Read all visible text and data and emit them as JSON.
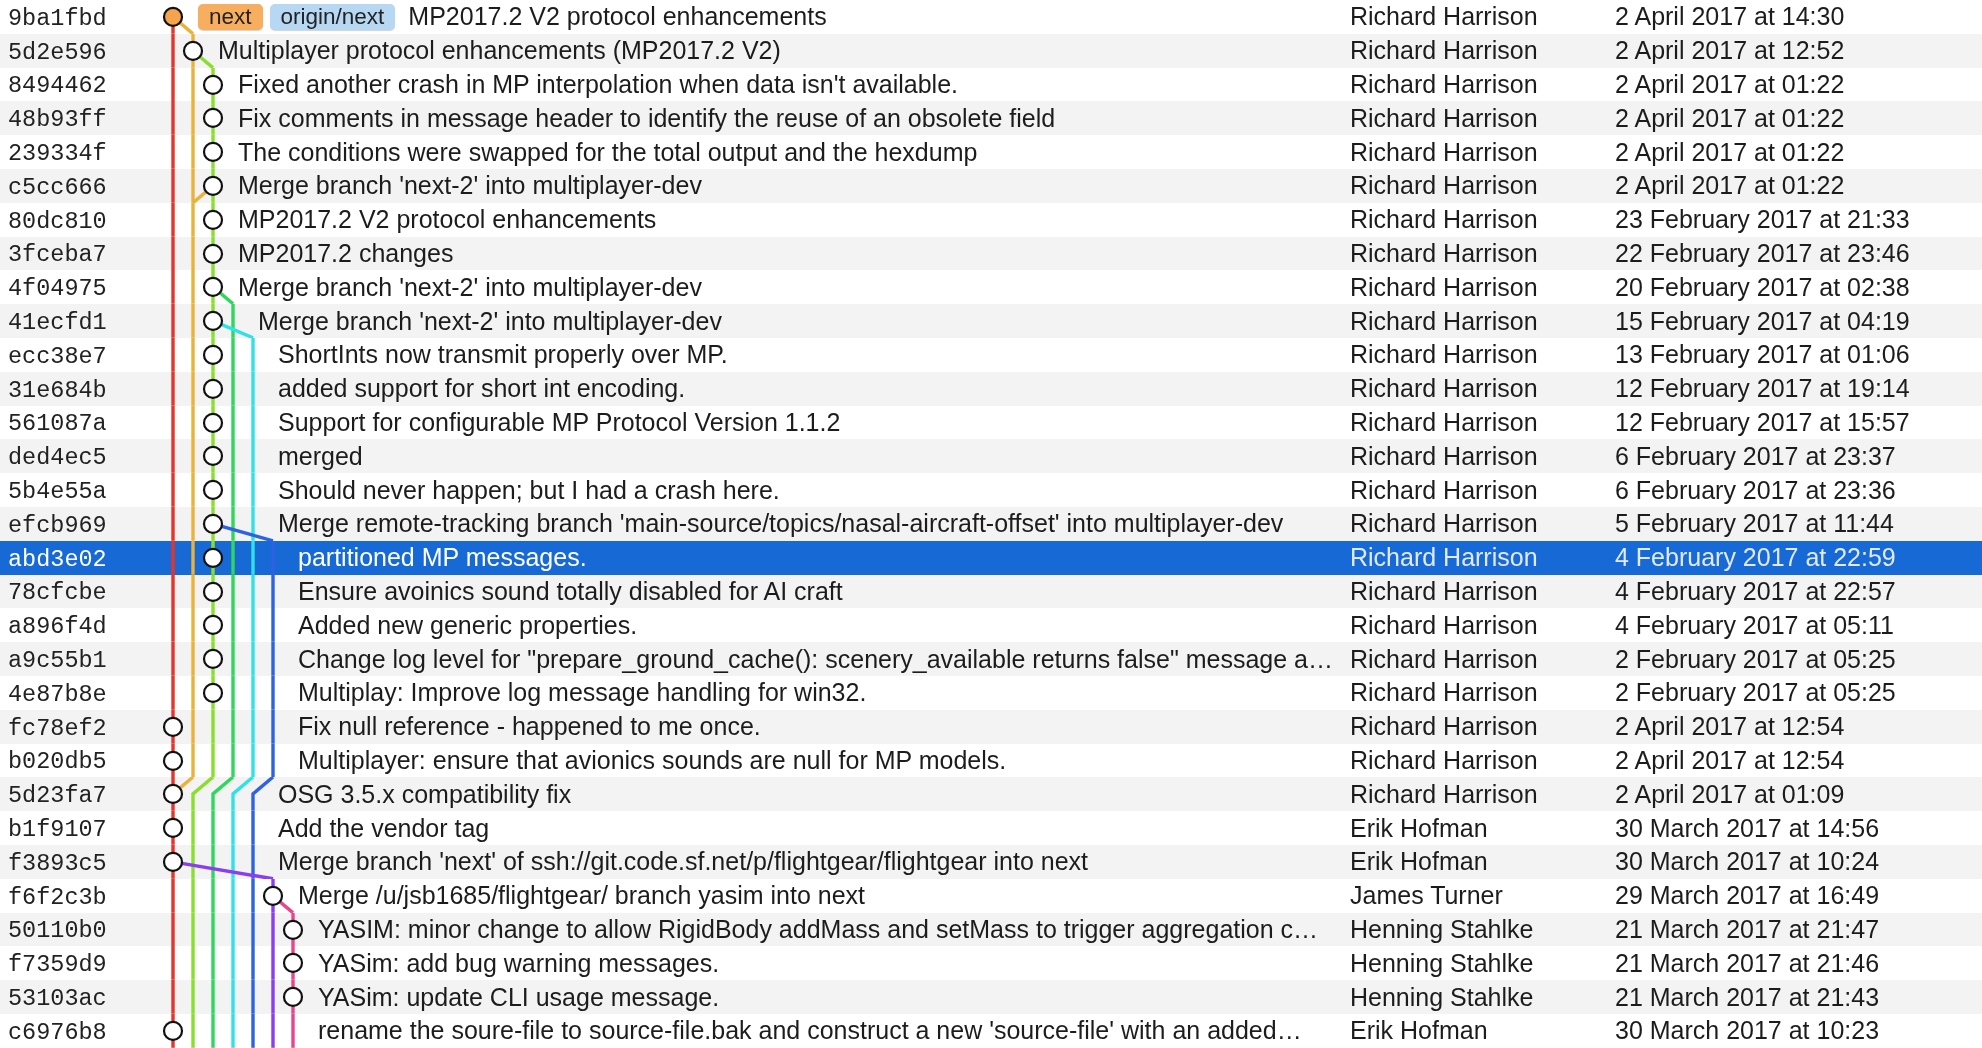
{
  "commits": [
    {
      "hash": "9ba1fbd",
      "refs": [
        {
          "name": "next",
          "kind": "local"
        },
        {
          "name": "origin/next",
          "kind": "remote"
        }
      ],
      "message": "MP2017.2 V2 protocol enhancements",
      "author": "Richard Harrison",
      "date": "2 April 2017 at 14:30",
      "head": true,
      "selected": false
    },
    {
      "hash": "5d2e596",
      "message": "Multiplayer protocol enhancements (MP2017.2 V2)",
      "author": "Richard Harrison",
      "date": "2 April 2017 at 12:52",
      "head": false,
      "selected": false
    },
    {
      "hash": "8494462",
      "message": "Fixed another crash in MP interpolation when data isn't available.",
      "author": "Richard Harrison",
      "date": "2 April 2017 at 01:22",
      "head": false,
      "selected": false
    },
    {
      "hash": "48b93ff",
      "message": "Fix comments in message header to identify the reuse of an obsolete field",
      "author": "Richard Harrison",
      "date": "2 April 2017 at 01:22",
      "head": false,
      "selected": false
    },
    {
      "hash": "239334f",
      "message": "The conditions were swapped for the total output and the hexdump",
      "author": "Richard Harrison",
      "date": "2 April 2017 at 01:22",
      "head": false,
      "selected": false
    },
    {
      "hash": "c5cc666",
      "message": "Merge branch 'next-2' into multiplayer-dev",
      "author": "Richard Harrison",
      "date": "2 April 2017 at 01:22",
      "head": false,
      "selected": false
    },
    {
      "hash": "80dc810",
      "message": "MP2017.2 V2 protocol enhancements",
      "author": "Richard Harrison",
      "date": "23 February 2017 at 21:33",
      "head": false,
      "selected": false
    },
    {
      "hash": "3fceba7",
      "message": "MP2017.2 changes",
      "author": "Richard Harrison",
      "date": "22 February 2017 at 23:46",
      "head": false,
      "selected": false
    },
    {
      "hash": "4f04975",
      "message": "Merge branch 'next-2' into multiplayer-dev",
      "author": "Richard Harrison",
      "date": "20 February 2017 at 02:38",
      "head": false,
      "selected": false
    },
    {
      "hash": "41ecfd1",
      "message": "Merge branch 'next-2' into multiplayer-dev",
      "author": "Richard Harrison",
      "date": "15 February 2017 at 04:19",
      "head": false,
      "selected": false
    },
    {
      "hash": "ecc38e7",
      "message": "ShortInts now transmit properly over MP.",
      "author": "Richard Harrison",
      "date": "13 February 2017 at 01:06",
      "head": false,
      "selected": false
    },
    {
      "hash": "31e684b",
      "message": "added support for short int encoding.",
      "author": "Richard Harrison",
      "date": "12 February 2017 at 19:14",
      "head": false,
      "selected": false
    },
    {
      "hash": "561087a",
      "message": "Support for configurable MP Protocol Version 1.1.2",
      "author": "Richard Harrison",
      "date": "12 February 2017 at 15:57",
      "head": false,
      "selected": false
    },
    {
      "hash": "ded4ec5",
      "message": "merged",
      "author": "Richard Harrison",
      "date": "6 February 2017 at 23:37",
      "head": false,
      "selected": false
    },
    {
      "hash": "5b4e55a",
      "message": "Should never happen; but I had a crash here.",
      "author": "Richard Harrison",
      "date": "6 February 2017 at 23:36",
      "head": false,
      "selected": false
    },
    {
      "hash": "efcb969",
      "message": "Merge remote-tracking branch 'main-source/topics/nasal-aircraft-offset' into multiplayer-dev",
      "author": "Richard Harrison",
      "date": "5 February 2017 at 11:44",
      "head": false,
      "selected": false
    },
    {
      "hash": "abd3e02",
      "message": "partitioned MP messages.",
      "author": "Richard Harrison",
      "date": "4 February 2017 at 22:59",
      "head": false,
      "selected": true
    },
    {
      "hash": "78cfcbe",
      "message": "Ensure avoinics sound totally disabled for AI craft",
      "author": "Richard Harrison",
      "date": "4 February 2017 at 22:57",
      "head": false,
      "selected": false
    },
    {
      "hash": "a896f4d",
      "message": "Added new generic properties.",
      "author": "Richard Harrison",
      "date": "4 February 2017 at 05:11",
      "head": false,
      "selected": false
    },
    {
      "hash": "a9c55b1",
      "message": "Change log level for \"prepare_ground_cache(): scenery_available returns false\" message a…",
      "author": "Richard Harrison",
      "date": "2 February 2017 at 05:25",
      "head": false,
      "selected": false
    },
    {
      "hash": "4e87b8e",
      "message": "Multiplay: Improve log message handling for win32.",
      "author": "Richard Harrison",
      "date": "2 February 2017 at 05:25",
      "head": false,
      "selected": false
    },
    {
      "hash": "fc78ef2",
      "message": "Fix null reference - happened to me once.",
      "author": "Richard Harrison",
      "date": "2 April 2017 at 12:54",
      "head": false,
      "selected": false
    },
    {
      "hash": "b020db5",
      "message": "Multiplayer: ensure that avionics sounds are null for MP models.",
      "author": "Richard Harrison",
      "date": "2 April 2017 at 12:54",
      "head": false,
      "selected": false
    },
    {
      "hash": "5d23fa7",
      "message": "OSG 3.5.x compatibility fix",
      "author": "Richard Harrison",
      "date": "2 April 2017 at 01:09",
      "head": false,
      "selected": false
    },
    {
      "hash": "b1f9107",
      "message": "Add the vendor tag",
      "author": "Erik Hofman",
      "date": "30 March 2017 at 14:56",
      "head": false,
      "selected": false
    },
    {
      "hash": "f3893c5",
      "message": "Merge branch 'next' of ssh://git.code.sf.net/p/flightgear/flightgear into next",
      "author": "Erik Hofman",
      "date": "30 March 2017 at 10:24",
      "head": false,
      "selected": false
    },
    {
      "hash": "f6f2c3b",
      "message": "Merge /u/jsb1685/flightgear/ branch yasim into next",
      "author": "James Turner",
      "date": "29 March 2017 at 16:49",
      "head": false,
      "selected": false
    },
    {
      "hash": "50110b0",
      "message": "YASIM: minor change to allow RigidBody addMass and setMass to trigger aggregation c…",
      "author": "Henning Stahlke",
      "date": "21 March 2017 at 21:47",
      "head": false,
      "selected": false
    },
    {
      "hash": "f7359d9",
      "message": "YASim: add bug warning messages.",
      "author": "Henning Stahlke",
      "date": "21 March 2017 at 21:46",
      "head": false,
      "selected": false
    },
    {
      "hash": "53103ac",
      "message": "YASim: update CLI usage message.",
      "author": "Henning Stahlke",
      "date": "21 March 2017 at 21:43",
      "head": false,
      "selected": false
    },
    {
      "hash": "c6976b8",
      "message": "rename the soure-file to source-file.bak and construct a new 'source-file' with an added…",
      "author": "Erik Hofman",
      "date": "30 March 2017 at 10:23",
      "head": false,
      "selected": false
    }
  ]
}
